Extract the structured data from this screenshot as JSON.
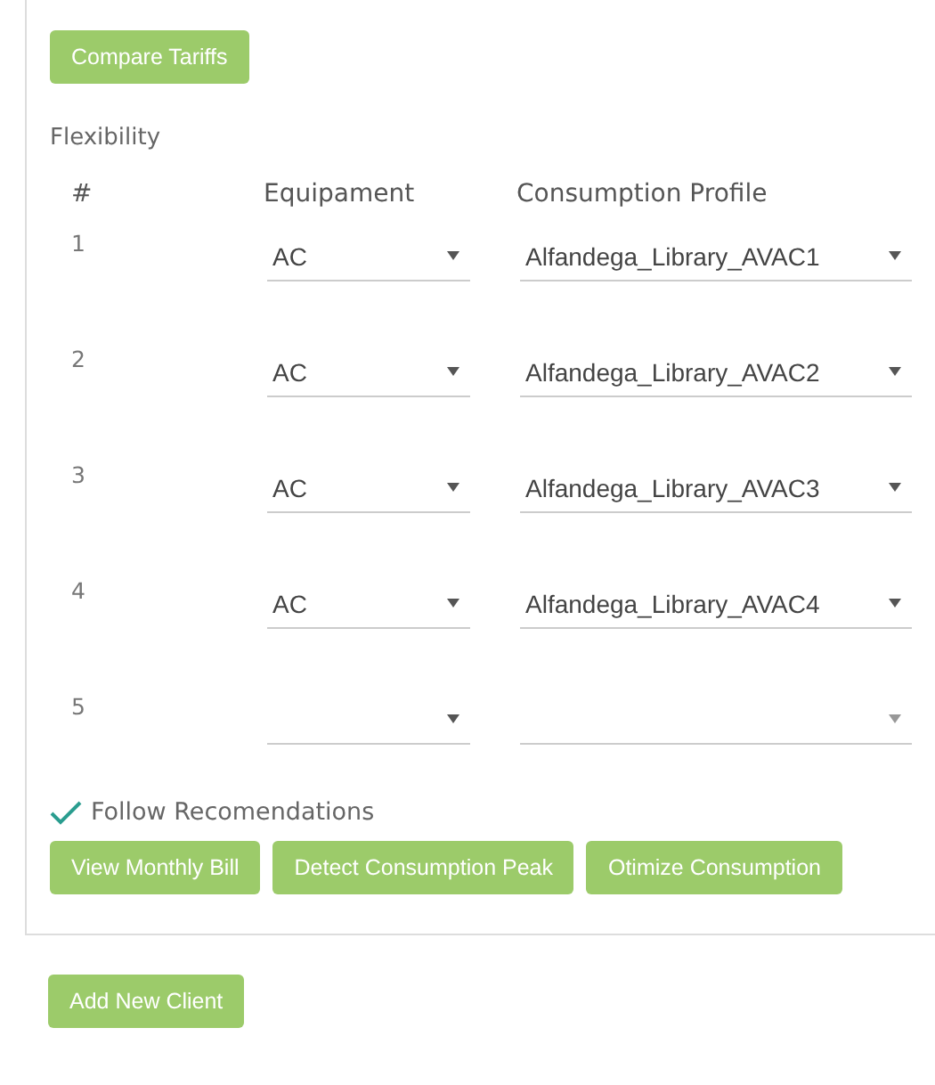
{
  "compare_button": "Compare Tariffs",
  "section_title": "Flexibility",
  "table": {
    "columns": [
      "#",
      "Equipament",
      "Consumption Profile"
    ],
    "rows": [
      {
        "number": "1",
        "equipment": "AC",
        "profile": "Alfandega_Library_AVAC1"
      },
      {
        "number": "2",
        "equipment": "AC",
        "profile": "Alfandega_Library_AVAC2"
      },
      {
        "number": "3",
        "equipment": "AC",
        "profile": "Alfandega_Library_AVAC3"
      },
      {
        "number": "4",
        "equipment": "AC",
        "profile": "Alfandega_Library_AVAC4"
      },
      {
        "number": "5",
        "equipment": "",
        "profile": ""
      }
    ]
  },
  "follow": {
    "label": "Follow Recomendations",
    "checked": true
  },
  "actions": [
    "View Monthly Bill",
    "Detect Consumption Peak",
    "Otimize Consumption"
  ],
  "add_button": "Add New Client"
}
